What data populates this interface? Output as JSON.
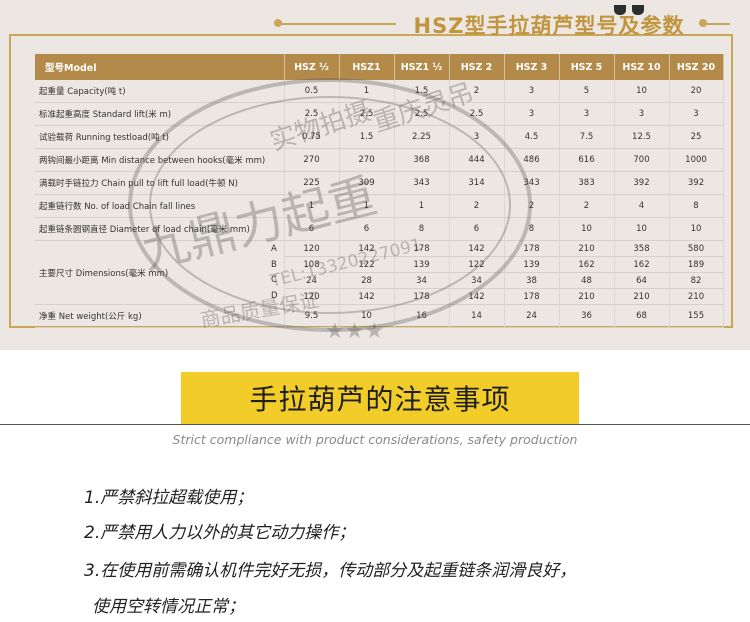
{
  "spec_title": "HSZ型手拉葫芦型号及参数",
  "table": {
    "headers": [
      "型号Model",
      "HSZ ½",
      "HSZ1",
      "HSZ1 ½",
      "HSZ 2",
      "HSZ 3",
      "HSZ 5",
      "HSZ 10",
      "HSZ 20"
    ],
    "rows": [
      {
        "label": "起重量  Capacity(吨 t)",
        "values": [
          "0.5",
          "1",
          "1.5",
          "2",
          "3",
          "5",
          "10",
          "20"
        ]
      },
      {
        "label": "标准起重高度  Standard lift(米 m)",
        "values": [
          "2.5",
          "2.5",
          "2.5",
          "2.5",
          "3",
          "3",
          "3",
          "3"
        ]
      },
      {
        "label": "试验载荷  Running testload(吨 t)",
        "values": [
          "0.75",
          "1.5",
          "2.25",
          "3",
          "4.5",
          "7.5",
          "12.5",
          "25"
        ]
      },
      {
        "label": "两钩间最小距离  Min distance between hooks(毫米 mm)",
        "values": [
          "270",
          "270",
          "368",
          "444",
          "486",
          "616",
          "700",
          "1000"
        ]
      },
      {
        "label": "满载时手链拉力  Chain pull to lift full load(牛顿 N)",
        "values": [
          "225",
          "309",
          "343",
          "314",
          "343",
          "383",
          "392",
          "392"
        ]
      },
      {
        "label": "起重链行数  No. of load Chain fall lines",
        "values": [
          "1",
          "1",
          "1",
          "2",
          "2",
          "2",
          "4",
          "8"
        ]
      },
      {
        "label": "起重链条圆钢直径  Diameter of load chain(毫米 mm)",
        "values": [
          "6",
          "6",
          "8",
          "6",
          "8",
          "10",
          "10",
          "10"
        ]
      }
    ],
    "dimensions": {
      "label": "主要尺寸  Dimensions(毫米 mm)",
      "rows": [
        {
          "sub": "A",
          "values": [
            "120",
            "142",
            "178",
            "142",
            "178",
            "210",
            "358",
            "580"
          ]
        },
        {
          "sub": "B",
          "values": [
            "108",
            "122",
            "139",
            "122",
            "139",
            "162",
            "162",
            "189"
          ]
        },
        {
          "sub": "C",
          "values": [
            "24",
            "28",
            "34",
            "34",
            "38",
            "48",
            "64",
            "82"
          ]
        },
        {
          "sub": "D",
          "values": [
            "120",
            "142",
            "178",
            "142",
            "178",
            "210",
            "210",
            "210"
          ]
        }
      ]
    },
    "weight_row": {
      "label": "净重  Net weight(公斤 kg)",
      "values": [
        "9.5",
        "10",
        "16",
        "14",
        "24",
        "36",
        "68",
        "155"
      ]
    }
  },
  "stamp": {
    "arc_text": "实物拍摄·重庆灵吊",
    "main_text": "九鼎力起重",
    "tel": "TEL:13320227091",
    "bottom_text": "商品质量保证"
  },
  "notice": {
    "title": "手拉葫芦的注意事项",
    "subtitle": "Strict compliance with product considerations, safety production",
    "items": [
      "1.严禁斜拉超载使用；",
      "2.严禁用人力以外的其它动力操作；",
      "3.在使用前需确认机件完好无损，传动部分及起重链条润滑良好，",
      "使用空转情况正常；"
    ]
  }
}
